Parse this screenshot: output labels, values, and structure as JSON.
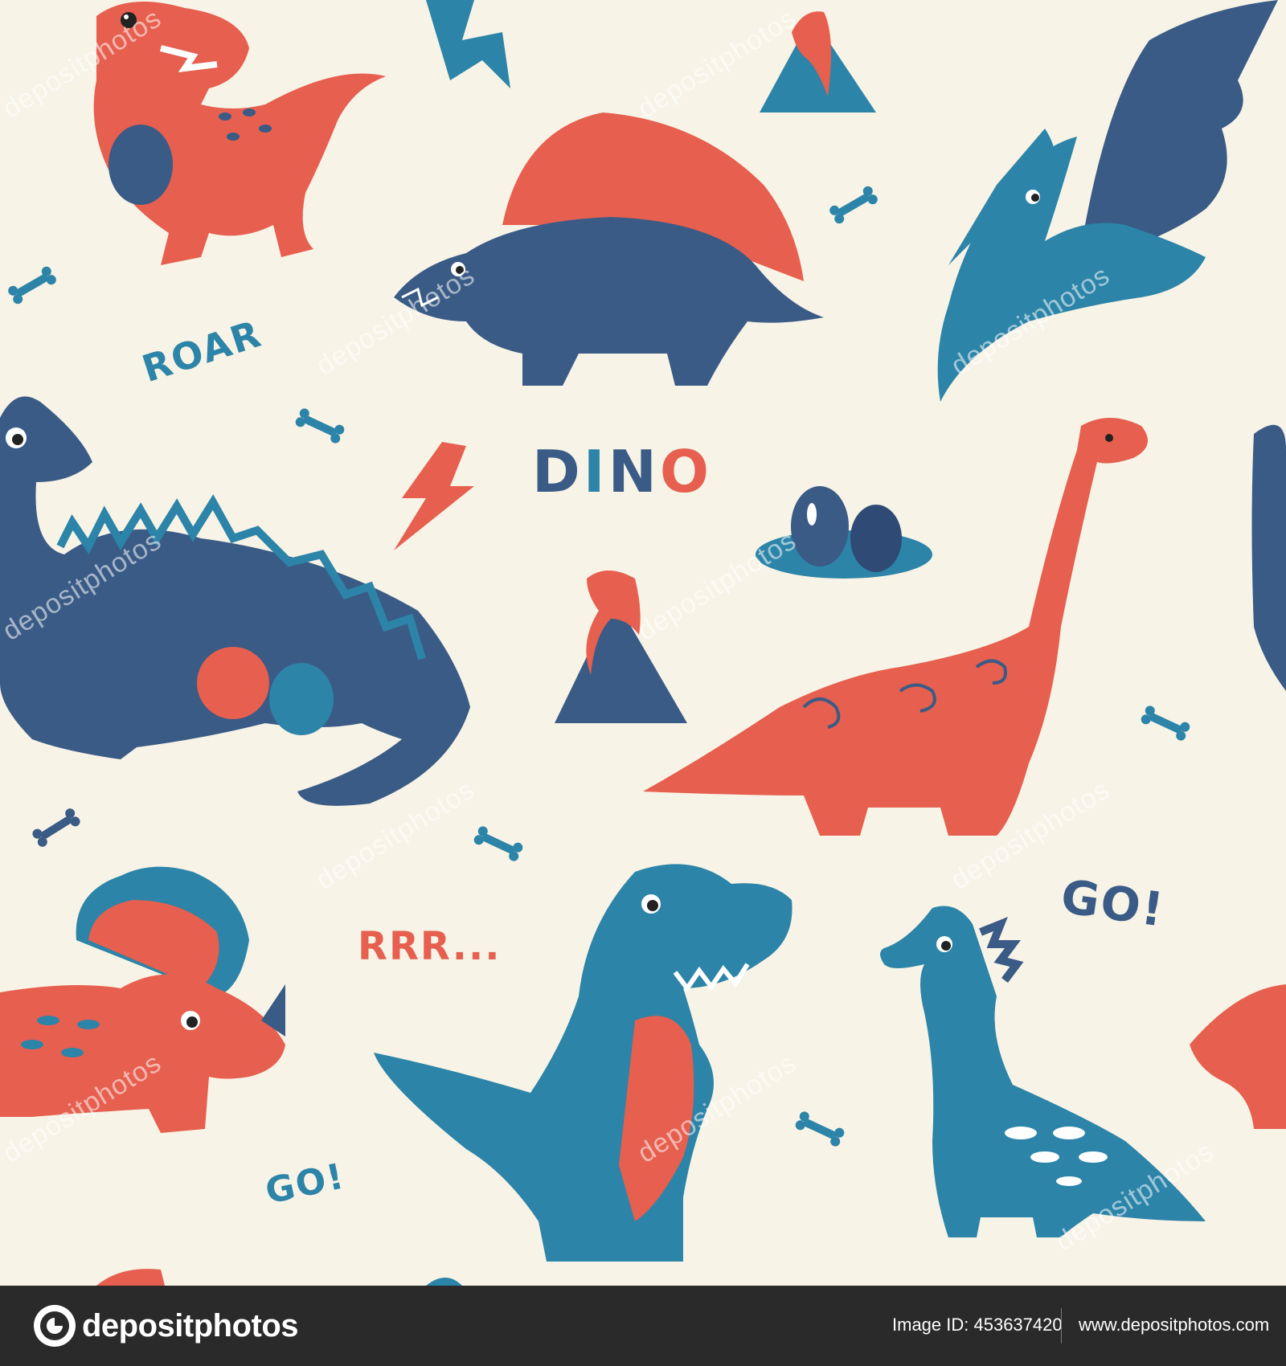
{
  "palette": {
    "background": "#f7f3e6",
    "red": "#e65f4f",
    "navy": "#3a5b86",
    "teal": "#2c84a8",
    "dark_navy": "#2f4a75",
    "footer": "#2a2a2a"
  },
  "pattern": {
    "words": {
      "roar": "ROAR",
      "dino_d": "D",
      "dino_i": "I",
      "dino_n": "N",
      "dino_o": "O",
      "rrr": "RRR...",
      "go_right": "GO!",
      "go_left": "GO!"
    },
    "figures": [
      "t-rex red",
      "stegosaurus navy",
      "pterodactyl",
      "ankylosaurus navy",
      "brachiosaurus red",
      "triceratops red",
      "t-rex teal",
      "dragon dino teal",
      "volcano",
      "dino eggs",
      "bones",
      "lightning bolts"
    ],
    "watermark": "depositphotos"
  },
  "footer": {
    "logo_text": "depositphotos",
    "image_id": "Image ID: 453637420",
    "site": "www.depositphotos.com"
  }
}
